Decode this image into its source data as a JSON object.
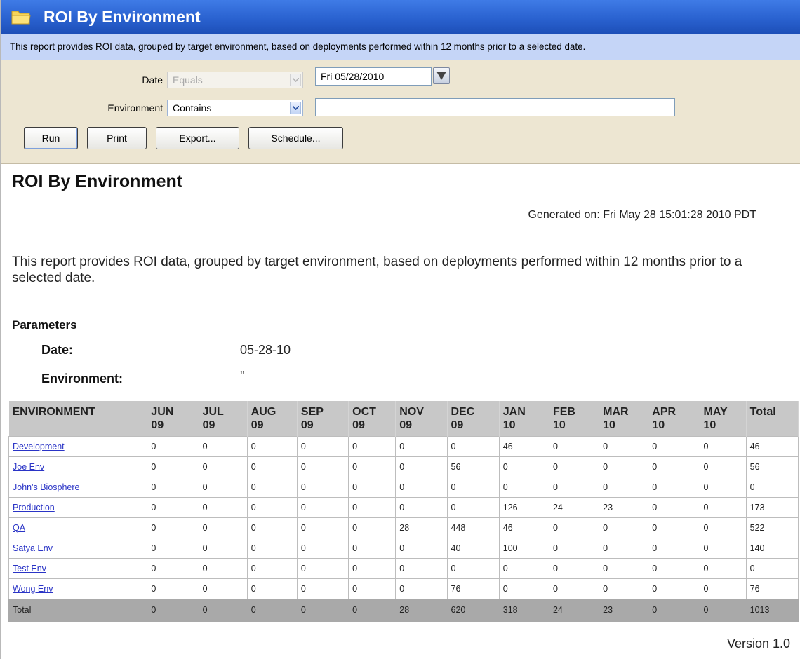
{
  "window": {
    "title": "ROI By Environment",
    "icon": "folder-icon",
    "description": "This report provides ROI data, grouped by target environment, based on deployments performed within 12 months prior to a selected date."
  },
  "filters": {
    "date_label": "Date",
    "date_operator": "Equals",
    "date_value": "Fri 05/28/2010",
    "environment_label": "Environment",
    "environment_operator": "Contains",
    "environment_value": ""
  },
  "buttons": {
    "run": "Run",
    "print": "Print",
    "export": "Export...",
    "schedule": "Schedule..."
  },
  "report": {
    "title": "ROI By Environment",
    "generated": "Generated on: Fri May 28 15:01:28 2010 PDT",
    "description": "This report provides ROI data, grouped by target environment, based on deployments performed within 12 months prior to a selected date.",
    "parameters_heading": "Parameters",
    "params": [
      {
        "name": "Date:",
        "value": "05-28-10"
      },
      {
        "name": "Environment:",
        "value": "''"
      }
    ],
    "version": "Version 1.0"
  },
  "table": {
    "columns": [
      [
        "ENVIRONMENT",
        ""
      ],
      [
        "JUN",
        "09"
      ],
      [
        "JUL",
        "09"
      ],
      [
        "AUG",
        "09"
      ],
      [
        "SEP",
        "09"
      ],
      [
        "OCT",
        "09"
      ],
      [
        "NOV",
        "09"
      ],
      [
        "DEC",
        "09"
      ],
      [
        "JAN",
        "10"
      ],
      [
        "FEB",
        "10"
      ],
      [
        "MAR",
        "10"
      ],
      [
        "APR",
        "10"
      ],
      [
        "MAY",
        "10"
      ],
      [
        "Total",
        ""
      ]
    ],
    "rows": [
      [
        "Development",
        "0",
        "0",
        "0",
        "0",
        "0",
        "0",
        "0",
        "46",
        "0",
        "0",
        "0",
        "0",
        "46"
      ],
      [
        "Joe Env",
        "0",
        "0",
        "0",
        "0",
        "0",
        "0",
        "56",
        "0",
        "0",
        "0",
        "0",
        "0",
        "56"
      ],
      [
        "John's Biosphere",
        "0",
        "0",
        "0",
        "0",
        "0",
        "0",
        "0",
        "0",
        "0",
        "0",
        "0",
        "0",
        "0"
      ],
      [
        "Production",
        "0",
        "0",
        "0",
        "0",
        "0",
        "0",
        "0",
        "126",
        "24",
        "23",
        "0",
        "0",
        "173"
      ],
      [
        "QA",
        "0",
        "0",
        "0",
        "0",
        "0",
        "28",
        "448",
        "46",
        "0",
        "0",
        "0",
        "0",
        "522"
      ],
      [
        "Satya Env",
        "0",
        "0",
        "0",
        "0",
        "0",
        "0",
        "40",
        "100",
        "0",
        "0",
        "0",
        "0",
        "140"
      ],
      [
        "Test Env",
        "0",
        "0",
        "0",
        "0",
        "0",
        "0",
        "0",
        "0",
        "0",
        "0",
        "0",
        "0",
        "0"
      ],
      [
        "Wong Env",
        "0",
        "0",
        "0",
        "0",
        "0",
        "0",
        "76",
        "0",
        "0",
        "0",
        "0",
        "0",
        "76"
      ]
    ],
    "total_row": [
      "Total",
      "0",
      "0",
      "0",
      "0",
      "0",
      "28",
      "620",
      "318",
      "24",
      "23",
      "0",
      "0",
      "1013"
    ]
  }
}
